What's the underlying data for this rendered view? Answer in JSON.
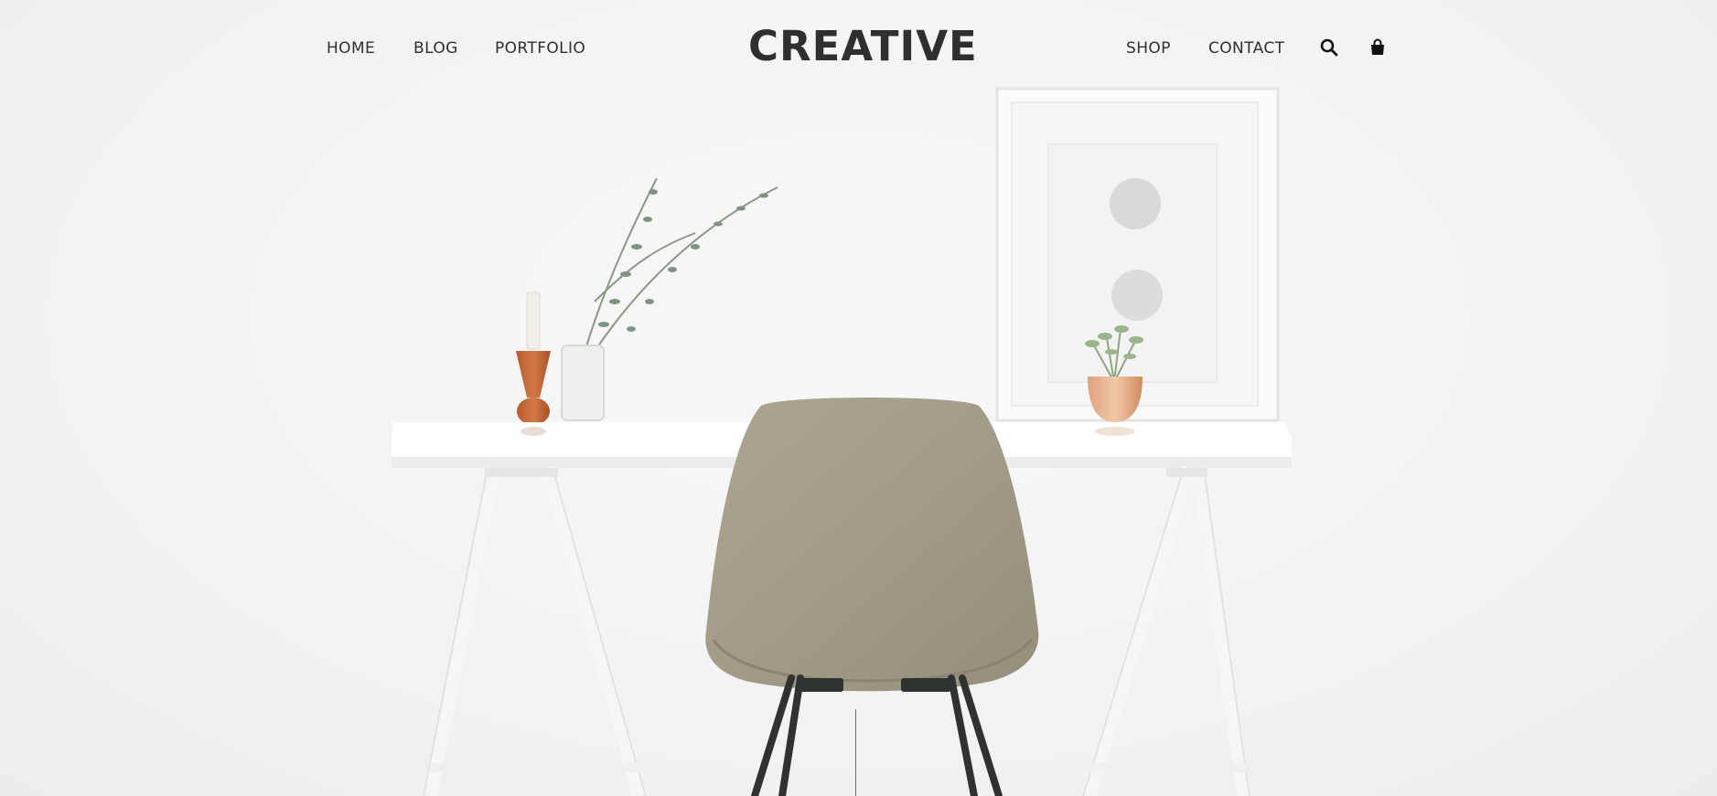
{
  "nav": {
    "left_items": [
      {
        "label": "HOME"
      },
      {
        "label": "BLOG"
      },
      {
        "label": "PORTFOLIO"
      }
    ],
    "logo": "CREATIVE",
    "right_items": [
      {
        "label": "SHOP"
      },
      {
        "label": "CONTACT"
      }
    ],
    "icons": [
      "search-icon",
      "shopping-bag-icon"
    ]
  },
  "colors": {
    "text": "#2f2f2f",
    "background": "#f4f4f4",
    "chair": "#a39c89",
    "copper": "#c9744a"
  }
}
